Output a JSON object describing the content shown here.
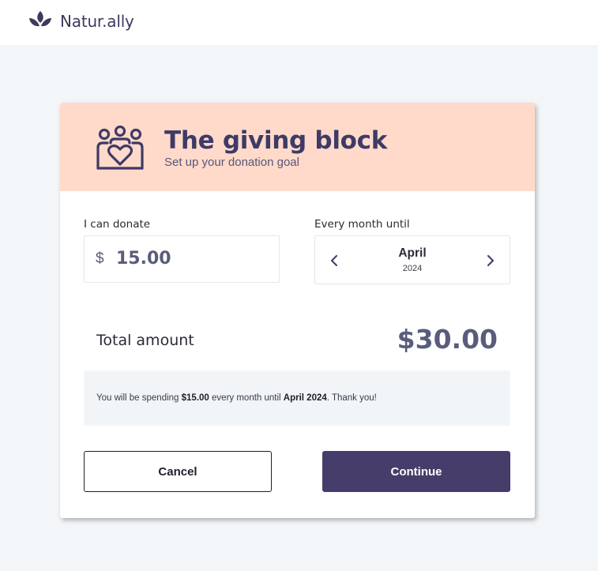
{
  "brand": {
    "name": "Natur.ally",
    "color": "#3d3a5c"
  },
  "card": {
    "title": "The giving block",
    "subtitle": "Set up your donation goal",
    "header_bg": "#ffdacb",
    "icon": "people-heart-icon"
  },
  "donation": {
    "label": "I can donate",
    "currency_symbol": "$",
    "amount": "15.00"
  },
  "period": {
    "label": "Every month until",
    "month": "April",
    "year": "2024"
  },
  "total": {
    "label": "Total amount",
    "value": "$30.00"
  },
  "summary": {
    "prefix": "You will be spending ",
    "amount": "$15.00",
    "middle": " every month until ",
    "until": "April 2024",
    "suffix": ". Thank you!"
  },
  "actions": {
    "cancel_label": "Cancel",
    "continue_label": "Continue",
    "continue_bg": "#463d6a"
  }
}
